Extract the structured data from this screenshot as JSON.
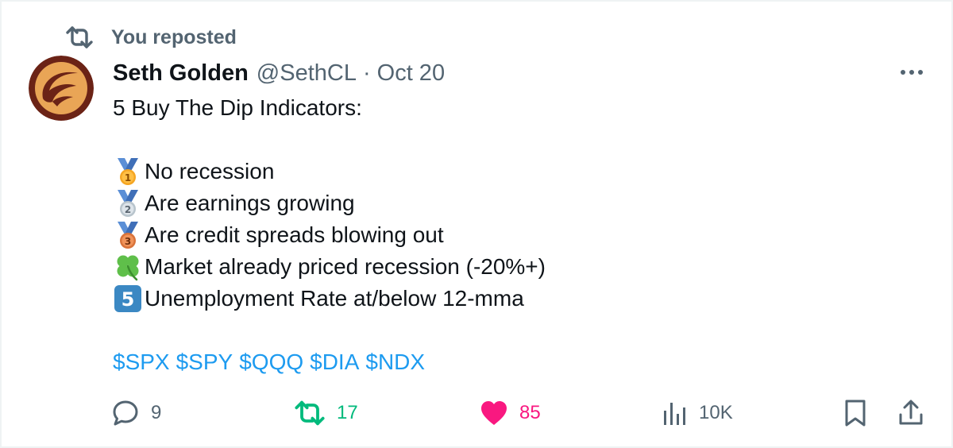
{
  "repost_banner": {
    "text": "You reposted"
  },
  "tweet": {
    "author_name": "Seth Golden",
    "handle": "@SethCL",
    "separator": "·",
    "date": "Oct 20",
    "text_title": "5 Buy The Dip Indicators:",
    "indicators": [
      {
        "icon": "first-place-medal-icon",
        "text": "No recession"
      },
      {
        "icon": "second-place-medal-icon",
        "text": "Are earnings growing"
      },
      {
        "icon": "third-place-medal-icon",
        "text": "Are credit spreads blowing out"
      },
      {
        "icon": "four-leaf-clover-icon",
        "text": "Market already priced recession (-20%+)"
      },
      {
        "icon": "keycap-five-icon",
        "text": "Unemployment Rate at/below 12-mma"
      }
    ],
    "tickers": [
      "$SPX",
      "$SPY",
      "$QQQ",
      "$DIA",
      "$NDX"
    ]
  },
  "actions": {
    "replies": "9",
    "reposts": "17",
    "likes": "85",
    "views": "10K"
  },
  "colors": {
    "accent_blue": "#1d9bf0",
    "repost_green": "#00ba7c",
    "like_pink": "#f91880",
    "secondary_text": "#536471",
    "primary_text": "#0f1419",
    "border": "#eff3f4"
  }
}
